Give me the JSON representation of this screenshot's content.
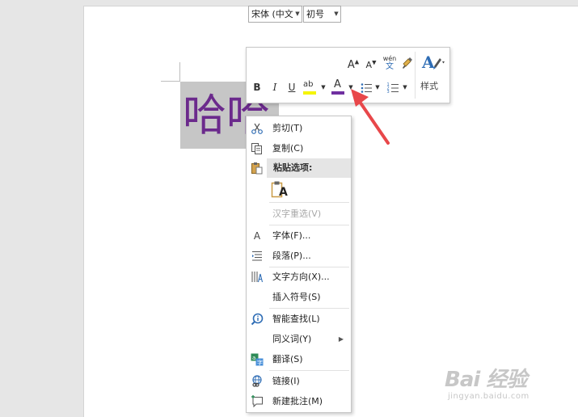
{
  "document": {
    "selected_text": "哈哈"
  },
  "mini_toolbar": {
    "font_name": "宋体 (中文",
    "font_size": "初号",
    "grow_font_label": "A",
    "shrink_font_label": "A",
    "pinyin_top": "wén",
    "pinyin_bottom": "文",
    "bold": "B",
    "italic": "I",
    "underline": "U",
    "highlight_label": "ab",
    "font_color_label": "A",
    "styles_label": "样式",
    "highlight_color": "#f5f500",
    "font_color": "#7030a0"
  },
  "context_menu": {
    "cut": "剪切(T)",
    "copy": "复制(C)",
    "paste_options_header": "粘贴选项:",
    "paste_keep_text_label": "A",
    "hanzi_reconvert": "汉字重选(V)",
    "font": "字体(F)...",
    "paragraph": "段落(P)...",
    "text_direction": "文字方向(X)...",
    "insert_symbol": "插入符号(S)",
    "smart_lookup": "智能查找(L)",
    "synonyms": "同义词(Y)",
    "translate": "翻译(S)",
    "link": "链接(I)",
    "new_comment": "新建批注(M)",
    "font_icon_label": "A",
    "submenu_arrow": "▶"
  },
  "watermark": {
    "brand": "Bai 经验",
    "url": "jingyan.baidu.com"
  },
  "colors": {
    "arrow": "#e8474a",
    "selected_text": "#6b2a8c",
    "selection_bg": "#c6c6c6"
  }
}
